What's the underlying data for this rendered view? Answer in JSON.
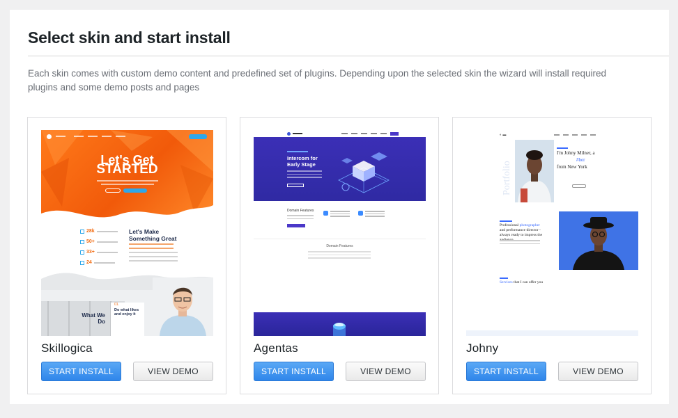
{
  "page": {
    "title": "Select skin and start install",
    "description": "Each skin comes with custom demo content and predefined set of plugins. Depending upon the selected skin the wizard will install required plugins and some demo posts and pages"
  },
  "skins": [
    {
      "name": "Skillogica",
      "install_label": "START INSTALL",
      "demo_label": "VIEW DEMO",
      "preview": {
        "hero_line1": "Let's Get",
        "hero_line2": "STARTED",
        "stats": [
          {
            "value": "28k"
          },
          {
            "value": "50+"
          },
          {
            "value": "33+"
          },
          {
            "value": "24"
          }
        ],
        "heading": "Let's Make Something Great",
        "what": "What We Do",
        "card_num": "01.",
        "card_title": "Do what likes and enjoy it"
      }
    },
    {
      "name": "Agentas",
      "install_label": "START INSTALL",
      "demo_label": "VIEW DEMO",
      "preview": {
        "hero_title": "Intercom for Early Stage",
        "section_title": "Domain Features",
        "mid_title": "Domain Features"
      }
    },
    {
      "name": "Johny",
      "install_label": "START INSTALL",
      "demo_label": "VIEW DEMO",
      "preview": {
        "vertical": "Portfolio",
        "intro1": "I'm Johny Milner, a",
        "intro2": "#ber",
        "intro3": "from New York",
        "sec_a": "Professional ",
        "sec_b": "photographer",
        "sec_c": " and performance director - always ready to impress the audience",
        "serv_a": "Services",
        "serv_b": " that I can offer you"
      }
    }
  ],
  "colors": {
    "accent": "#2f86ea",
    "skillogica_orange": "#f15a0a",
    "agentas_purple": "#3b2fb6",
    "johny_blue": "#3f73e6"
  }
}
